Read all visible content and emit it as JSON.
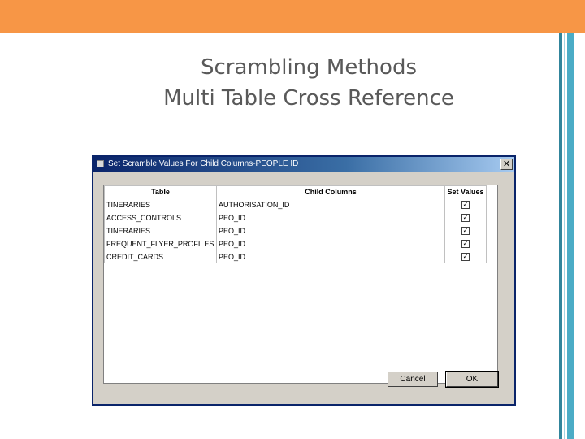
{
  "slide": {
    "title_line1": "Scrambling Methods",
    "title_line2": "Multi Table Cross Reference"
  },
  "dialog": {
    "title": "Set Scramble Values For Child Columns-PEOPLE ID",
    "close_glyph": "✕",
    "columns": [
      "Table",
      "Child Columns",
      "Set Values"
    ],
    "rows": [
      {
        "table": "TINERARIES",
        "child": "AUTHORISATION_ID",
        "checked": true
      },
      {
        "table": "ACCESS_CONTROLS",
        "child": "PEO_ID",
        "checked": true
      },
      {
        "table": "TINERARIES",
        "child": "PEO_ID",
        "checked": true
      },
      {
        "table": "FREQUENT_FLYER_PROFILES",
        "child": "PEO_ID",
        "checked": true
      },
      {
        "table": "CREDIT_CARDS",
        "child": "PEO_ID",
        "checked": true
      }
    ],
    "checkbox_glyph": "✓",
    "cancel_label": "Cancel",
    "ok_label": "OK"
  }
}
